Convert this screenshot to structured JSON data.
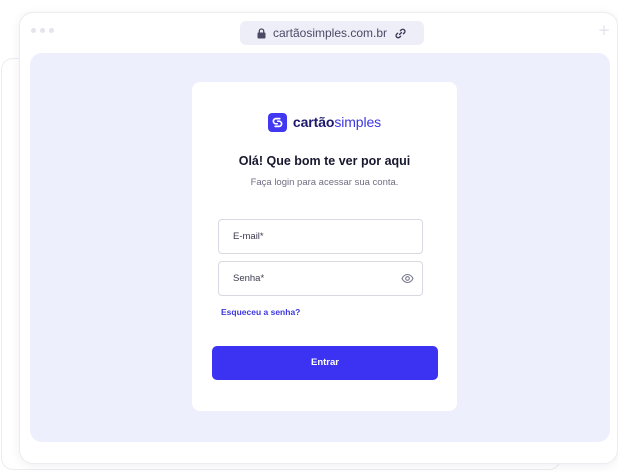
{
  "browser": {
    "url": "cartãosimples.com.br",
    "icons": {
      "lock": "lock-icon",
      "link": "link-icon",
      "new_tab": "plus-icon"
    }
  },
  "brand": {
    "name_bold": "cartão",
    "name_regular": "simples",
    "logo_icon": "cartaosimples-logo-icon",
    "color": "#3d37e0"
  },
  "login": {
    "heading": "Olá! Que bom te ver por aqui",
    "subtitle": "Faça login para acessar sua conta.",
    "email_placeholder": "E-mail*",
    "password_placeholder": "Senha*",
    "password_toggle_icon": "eye-icon",
    "forgot_password": "Esqueceu a senha?",
    "submit_label": "Entrar",
    "accent_color": "#3c32f1"
  }
}
